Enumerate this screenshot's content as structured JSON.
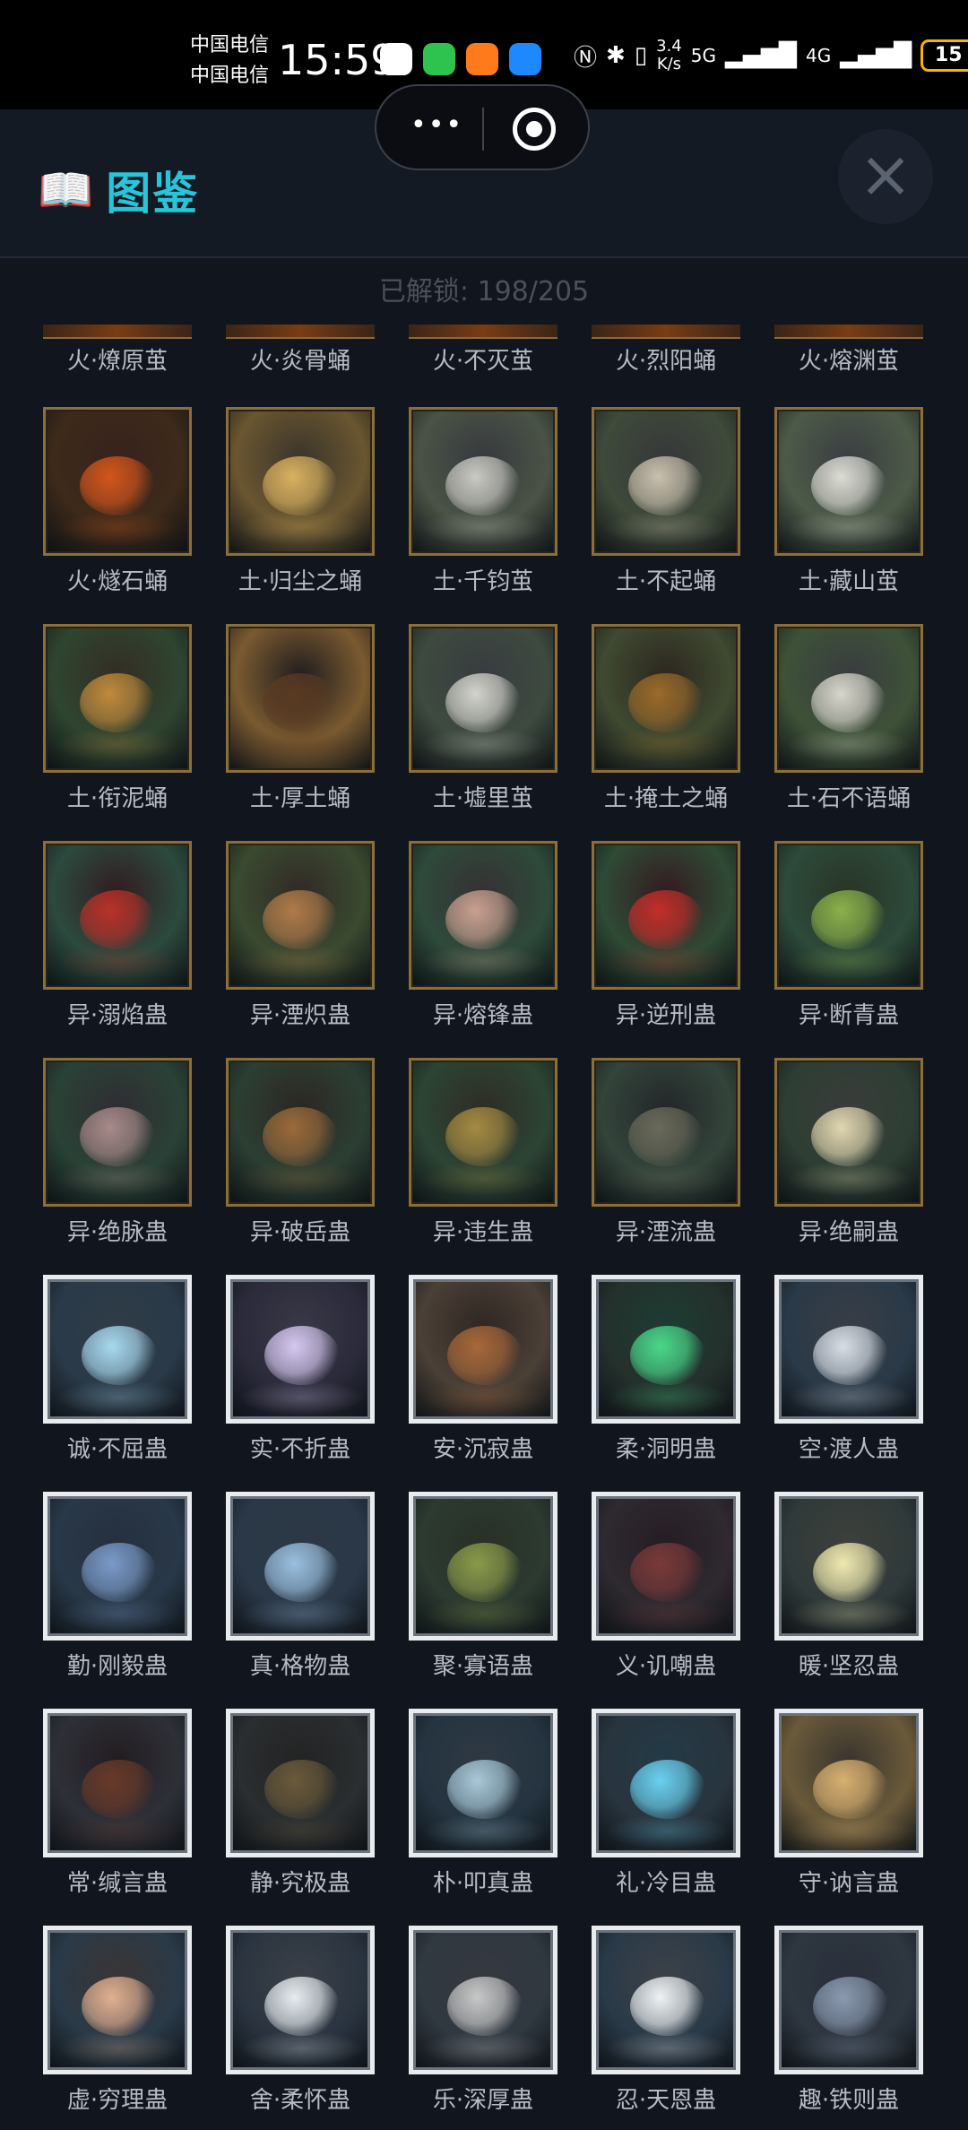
{
  "status": {
    "carrier1": "中国电信",
    "carrier2": "中国电信",
    "time": "15:59",
    "speed_value": "3.4",
    "speed_unit": "K/s",
    "net1": "5G",
    "net2": "4G",
    "battery": "15"
  },
  "header": {
    "title": "图鉴",
    "book_icon": "📖",
    "close_icon": "×"
  },
  "unlock_text": "已解锁: 198/205",
  "partial_row": [
    "火·燎原茧",
    "火·炎骨蛹",
    "火·不灭茧",
    "火·烈阳蛹",
    "火·熔渊茧"
  ],
  "rows": [
    {
      "style": "gold",
      "items": [
        {
          "label": "火·燧石蛹",
          "bg": "#3d2a1a",
          "accent": "#d3561c"
        },
        {
          "label": "土·归尘之蛹",
          "bg": "#6a5630",
          "accent": "#d9b160"
        },
        {
          "label": "土·千钧茧",
          "bg": "#4a5346",
          "accent": "#c9c9c2"
        },
        {
          "label": "土·不起蛹",
          "bg": "#3f4a3a",
          "accent": "#c9c0ad"
        },
        {
          "label": "土·藏山茧",
          "bg": "#4d5a48",
          "accent": "#dcdcd4"
        }
      ]
    },
    {
      "style": "gold",
      "items": [
        {
          "label": "土·衔泥蛹",
          "bg": "#2f4530",
          "accent": "#c08a3c"
        },
        {
          "label": "土·厚土蛹",
          "bg": "#7a5a30",
          "accent": "#5a3a22"
        },
        {
          "label": "土·墟里茧",
          "bg": "#3e4a3f",
          "accent": "#d3d3cc"
        },
        {
          "label": "土·掩土之蛹",
          "bg": "#3f4a30",
          "accent": "#9a6a2a"
        },
        {
          "label": "土·石不语蛹",
          "bg": "#3e5238",
          "accent": "#d8d6cc"
        }
      ]
    },
    {
      "style": "gold",
      "items": [
        {
          "label": "异·溺焰蛊",
          "bg": "#2c4a3e",
          "accent": "#b8322a"
        },
        {
          "label": "异·湮炽蛊",
          "bg": "#3a4a30",
          "accent": "#b07a4a"
        },
        {
          "label": "异·熔锋蛊",
          "bg": "#2e4a3a",
          "accent": "#c9a090"
        },
        {
          "label": "异·逆刑蛊",
          "bg": "#2f4a35",
          "accent": "#c22e2a"
        },
        {
          "label": "异·断青蛊",
          "bg": "#2d4a3a",
          "accent": "#8ab04a"
        }
      ]
    },
    {
      "style": "gold",
      "items": [
        {
          "label": "异·绝脉蛊",
          "bg": "#2a4236",
          "accent": "#a88a8a"
        },
        {
          "label": "异·破岳蛊",
          "bg": "#2c3f33",
          "accent": "#9a6a3a"
        },
        {
          "label": "异·违生蛊",
          "bg": "#2c4434",
          "accent": "#a58a42"
        },
        {
          "label": "异·湮流蛊",
          "bg": "#33443a",
          "accent": "#6a6a5a"
        },
        {
          "label": "异·绝嗣蛊",
          "bg": "#2d3e33",
          "accent": "#e0d6b0"
        }
      ]
    },
    {
      "style": "silver",
      "items": [
        {
          "label": "诚·不屈蛊",
          "bg": "#2a3a48",
          "accent": "#a8d8ee"
        },
        {
          "label": "实·不折蛊",
          "bg": "#2a2a3a",
          "accent": "#d6c8f0"
        },
        {
          "label": "安·沉寂蛊",
          "bg": "#4a4036",
          "accent": "#a8683a"
        },
        {
          "label": "柔·洞明蛊",
          "bg": "#24302c",
          "accent": "#4ad88a"
        },
        {
          "label": "空·渡人蛊",
          "bg": "#2a3a48",
          "accent": "#d8dee6"
        }
      ]
    },
    {
      "style": "silver",
      "items": [
        {
          "label": "勤·刚毅蛊",
          "bg": "#283848",
          "accent": "#7a9ac8"
        },
        {
          "label": "真·格物蛊",
          "bg": "#2a3848",
          "accent": "#9ac0e0"
        },
        {
          "label": "聚·寡语蛊",
          "bg": "#2c3a30",
          "accent": "#8a9a4a"
        },
        {
          "label": "义·讥嘲蛊",
          "bg": "#2e2a30",
          "accent": "#7a3a3a"
        },
        {
          "label": "暖·坚忍蛊",
          "bg": "#303a3a",
          "accent": "#f0eab0"
        }
      ]
    },
    {
      "style": "silver",
      "items": [
        {
          "label": "常·缄言蛊",
          "bg": "#2e3038",
          "accent": "#6a3a2a"
        },
        {
          "label": "静·究极蛊",
          "bg": "#2a2e30",
          "accent": "#6a5a3a"
        },
        {
          "label": "朴·叩真蛊",
          "bg": "#243440",
          "accent": "#a8c8d8"
        },
        {
          "label": "礼·冷目蛊",
          "bg": "#28343e",
          "accent": "#6ad0f0"
        },
        {
          "label": "守·讷言蛊",
          "bg": "#6a5a3a",
          "accent": "#d8b070"
        }
      ]
    },
    {
      "style": "silver",
      "items": [
        {
          "label": "虚·穷理蛊",
          "bg": "#2a3a48",
          "accent": "#e0b090"
        },
        {
          "label": "舍·柔怀蛊",
          "bg": "#2a3440",
          "accent": "#e6ecf0"
        },
        {
          "label": "乐·深厚蛊",
          "bg": "#303840",
          "accent": "#c8c8c8"
        },
        {
          "label": "忍·天恩蛊",
          "bg": "#2a3a48",
          "accent": "#eef2f4"
        },
        {
          "label": "趣·铁则蛊",
          "bg": "#2e3640",
          "accent": "#8a9ab0"
        }
      ]
    }
  ],
  "colors": {
    "accent": "#29c4d8",
    "gold_frame": "#8a6e3c",
    "silver_frame": "#e8ecef"
  }
}
